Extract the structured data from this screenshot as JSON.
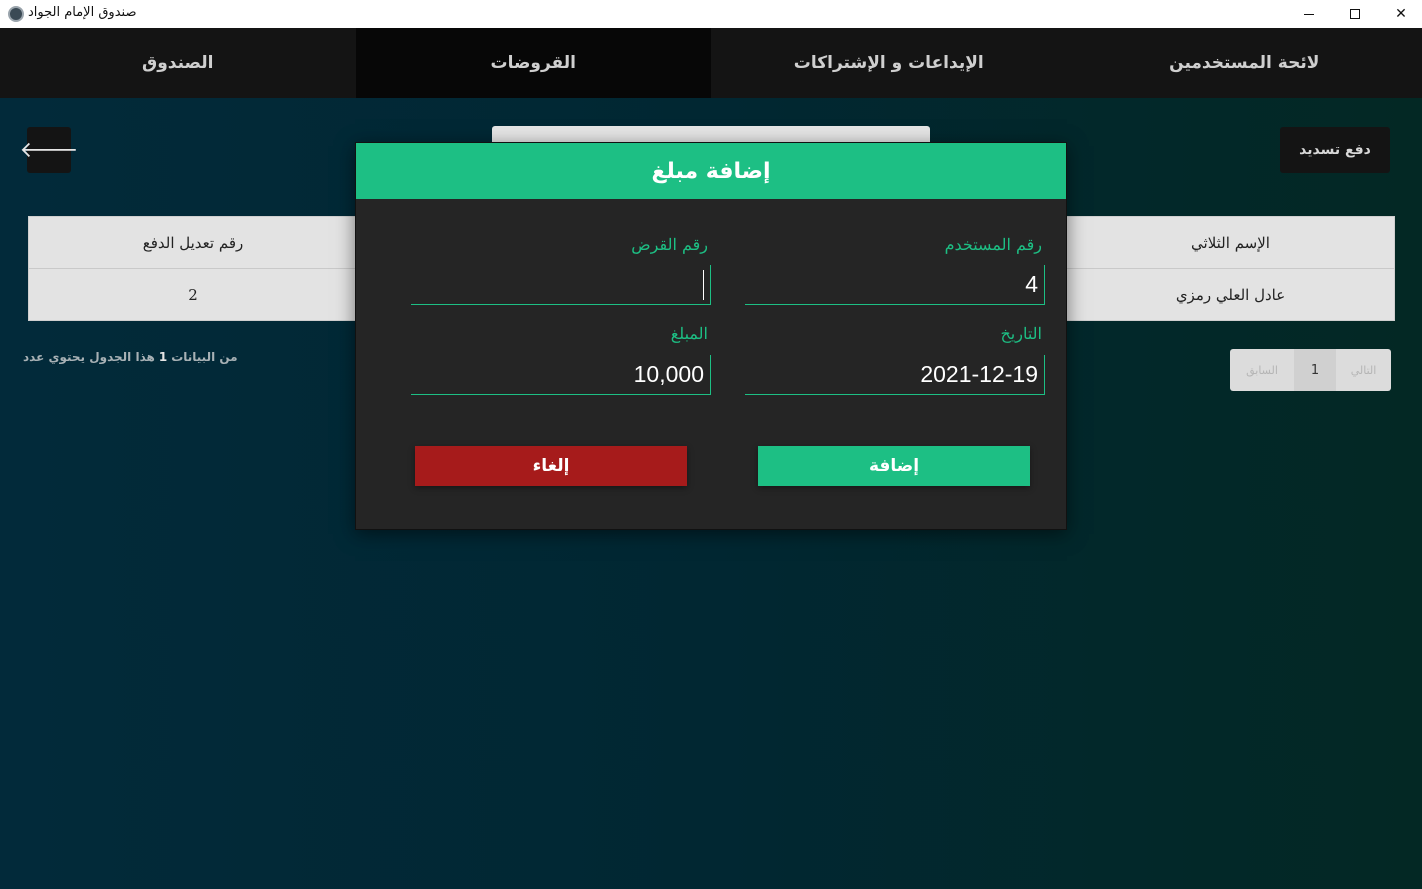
{
  "window": {
    "title": "صندوق الإمام الجواد",
    "minimize": "—",
    "maximize": "☐",
    "close": "✕"
  },
  "tabs": [
    {
      "label": "لائحة المستخدمين",
      "active": false
    },
    {
      "label": "الإيداعات و الإشتراكات",
      "active": false
    },
    {
      "label": "القروضات",
      "active": true
    },
    {
      "label": "الصندوق",
      "active": false
    }
  ],
  "toolbar": {
    "pay_button": "دفع تسديد",
    "back_icon": "arrow-left-icon",
    "back_glyph": "🡐"
  },
  "table_left": {
    "header": "رقم تعديل الدفع",
    "cell": "2"
  },
  "table_right": {
    "header": "الإسم الثلاثي",
    "cell": "عادل العلي رمزي"
  },
  "table_info": {
    "prefix": "هذا الجدول يحتوي عدد",
    "count": "1",
    "suffix": "من البيانات"
  },
  "pager": {
    "next": "التالي",
    "page": "1",
    "prev": "السابق"
  },
  "modal": {
    "title": "إضافة مبلغ",
    "user_id_label": "رقم المستخدم",
    "user_id_value": "4",
    "loan_id_label": "رقم القرض",
    "loan_id_value": "",
    "date_label": "التاريخ",
    "date_value": "2021-12-19",
    "amount_label": "المبلغ",
    "amount_value": "10,000",
    "add_button": "إضافة",
    "cancel_button": "إلغاء"
  },
  "colors": {
    "accent": "#1dbf84",
    "danger": "#a61b1b",
    "tab_bg": "#141414",
    "modal_bg": "#252525"
  }
}
